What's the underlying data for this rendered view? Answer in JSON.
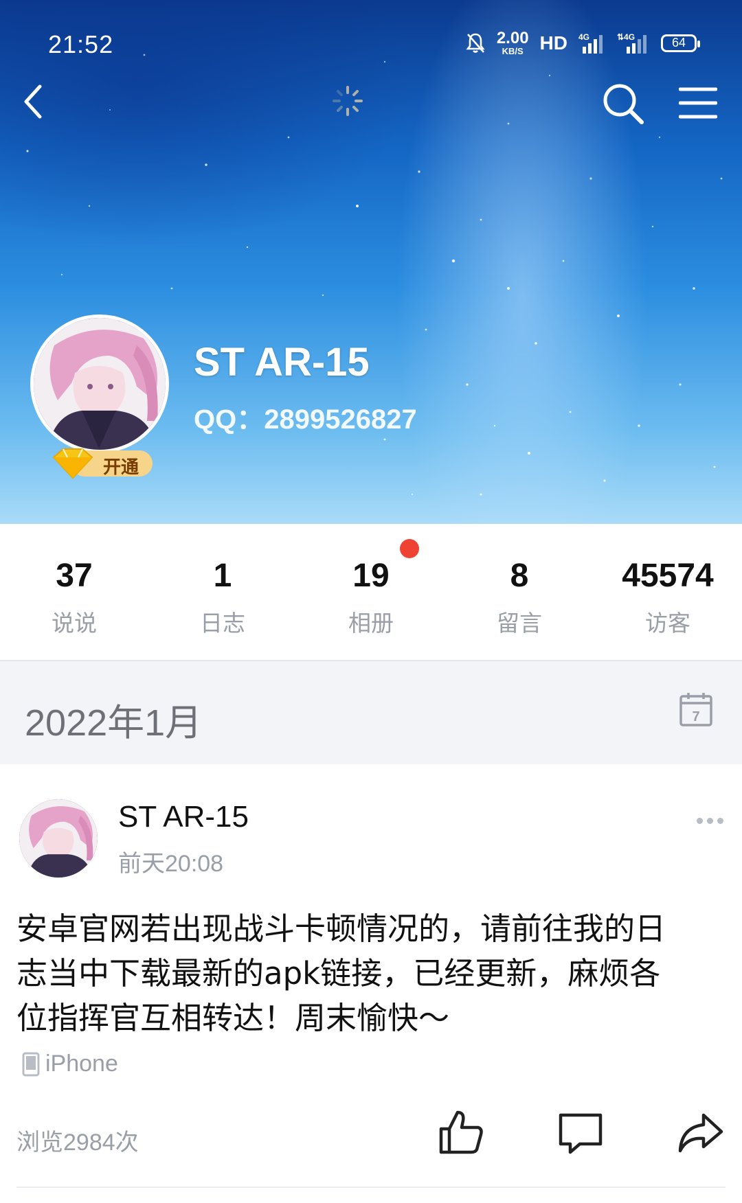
{
  "status_bar": {
    "time": "21:52",
    "speed_value": "2.00",
    "speed_unit": "KB/S",
    "hd": "HD",
    "battery": "64",
    "icons": [
      "mute-bell-icon",
      "4g-signal-icon",
      "4g-signal-icon"
    ]
  },
  "nav": {
    "back_icon": "chevron-left-icon",
    "loading_icon": "spinner-icon",
    "search_icon": "search-icon",
    "menu_icon": "hamburger-menu-icon"
  },
  "profile": {
    "name": "ST AR-15",
    "qq": "QQ：2899526827",
    "vip_label": "开通"
  },
  "stats": [
    {
      "value": "37",
      "label": "说说"
    },
    {
      "value": "1",
      "label": "日志"
    },
    {
      "value": "19",
      "label": "相册",
      "has_red_dot": true
    },
    {
      "value": "8",
      "label": "留言"
    },
    {
      "value": "45574",
      "label": "访客"
    }
  ],
  "month": {
    "label": "2022年1月",
    "calendar_day": "7"
  },
  "post": {
    "author": "ST AR-15",
    "time": "前天20:08",
    "lines": [
      "安卓官网若出现战斗卡顿情况的，请前往我的日",
      "志当中下载最新的apk链接，已经更新，麻烦各",
      "位指挥官互相转达！周末愉快～"
    ],
    "device": "iPhone",
    "views": "浏览2984次"
  },
  "colors": {
    "red_dot": "#ee4232",
    "muted_text": "#9a9ea6",
    "month_bg": "#f3f4f7",
    "sky_top": "#0b3a8f",
    "sky_bottom": "#a9dbf8"
  }
}
